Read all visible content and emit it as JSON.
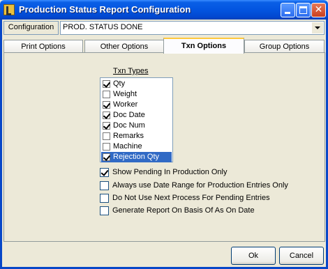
{
  "window": {
    "title": "Production Status Report Configuration"
  },
  "config": {
    "label": "Configuration",
    "value": "PROD. STATUS DONE"
  },
  "tabs": [
    {
      "label": "Print Options"
    },
    {
      "label": "Other Options"
    },
    {
      "label": "Txn Options",
      "active": true
    },
    {
      "label": "Group Options"
    }
  ],
  "txn_types": {
    "title": "Txn Types",
    "items": [
      {
        "label": "Qty",
        "checked": true
      },
      {
        "label": "Weight",
        "checked": false
      },
      {
        "label": "Worker",
        "checked": true
      },
      {
        "label": "Doc Date",
        "checked": true
      },
      {
        "label": "Doc Num",
        "checked": true
      },
      {
        "label": "Remarks",
        "checked": false
      },
      {
        "label": "Machine",
        "checked": false
      },
      {
        "label": "Rejection Qty",
        "checked": true,
        "selected": true
      }
    ]
  },
  "options": [
    {
      "label": "Show Pending In Production Only",
      "checked": true
    },
    {
      "label": "Always use Date Range for Production Entries Only",
      "checked": false
    },
    {
      "label": "Do Not Use Next Process For Pending Entries",
      "checked": false
    },
    {
      "label": "Generate Report On Basis Of As On Date",
      "checked": false
    }
  ],
  "buttons": {
    "ok": "Ok",
    "cancel": "Cancel"
  },
  "colors": {
    "titlebar": "#0355E0",
    "selection": "#316AC5",
    "face": "#ECE9D8"
  }
}
